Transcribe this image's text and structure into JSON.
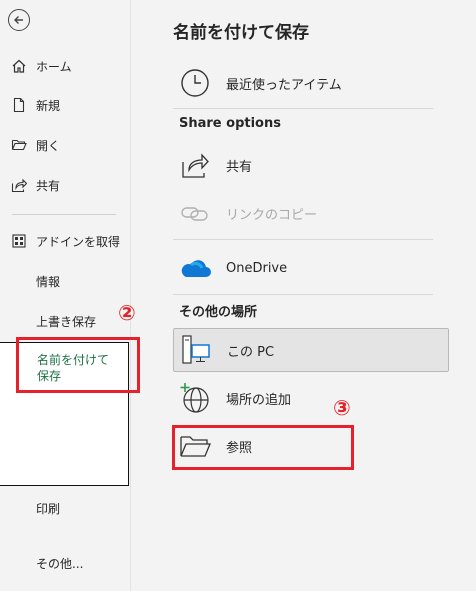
{
  "sidebar": {
    "items": [
      {
        "label": "ホーム",
        "icon": "home-icon"
      },
      {
        "label": "新規",
        "icon": "new-document-icon"
      },
      {
        "label": "開く",
        "icon": "open-folder-icon"
      },
      {
        "label": "共有",
        "icon": "share-icon"
      },
      {
        "label": "アドインを取得",
        "icon": "add-ins-grid-icon"
      },
      {
        "label": "情報"
      },
      {
        "label": "上書き保存"
      },
      {
        "label": "名前を付けて保存"
      },
      {
        "label": "印刷"
      },
      {
        "label": "その他..."
      }
    ]
  },
  "annotations": {
    "step2": "②",
    "step3": "③"
  },
  "main": {
    "title": "名前を付けて保存",
    "recent": {
      "label": "最近使ったアイテム",
      "icon": "clock-icon"
    },
    "share_options_header": "Share options",
    "share": {
      "label": "共有",
      "icon": "share-arrow-icon"
    },
    "copy_link": {
      "label": "リンクのコピー",
      "icon": "link-icon"
    },
    "onedrive": {
      "label": "OneDrive",
      "icon": "onedrive-cloud-icon"
    },
    "other_locations_header": "その他の場所",
    "this_pc": {
      "label": "この PC",
      "icon": "pc-icon"
    },
    "add_place": {
      "label": "場所の追加",
      "icon": "globe-add-icon"
    },
    "browse": {
      "label": "参照",
      "icon": "folder-icon"
    }
  },
  "colors": {
    "active_text": "#1e7145",
    "annotation_red": "#e5222b",
    "onedrive_blue": "#0f78d4"
  }
}
